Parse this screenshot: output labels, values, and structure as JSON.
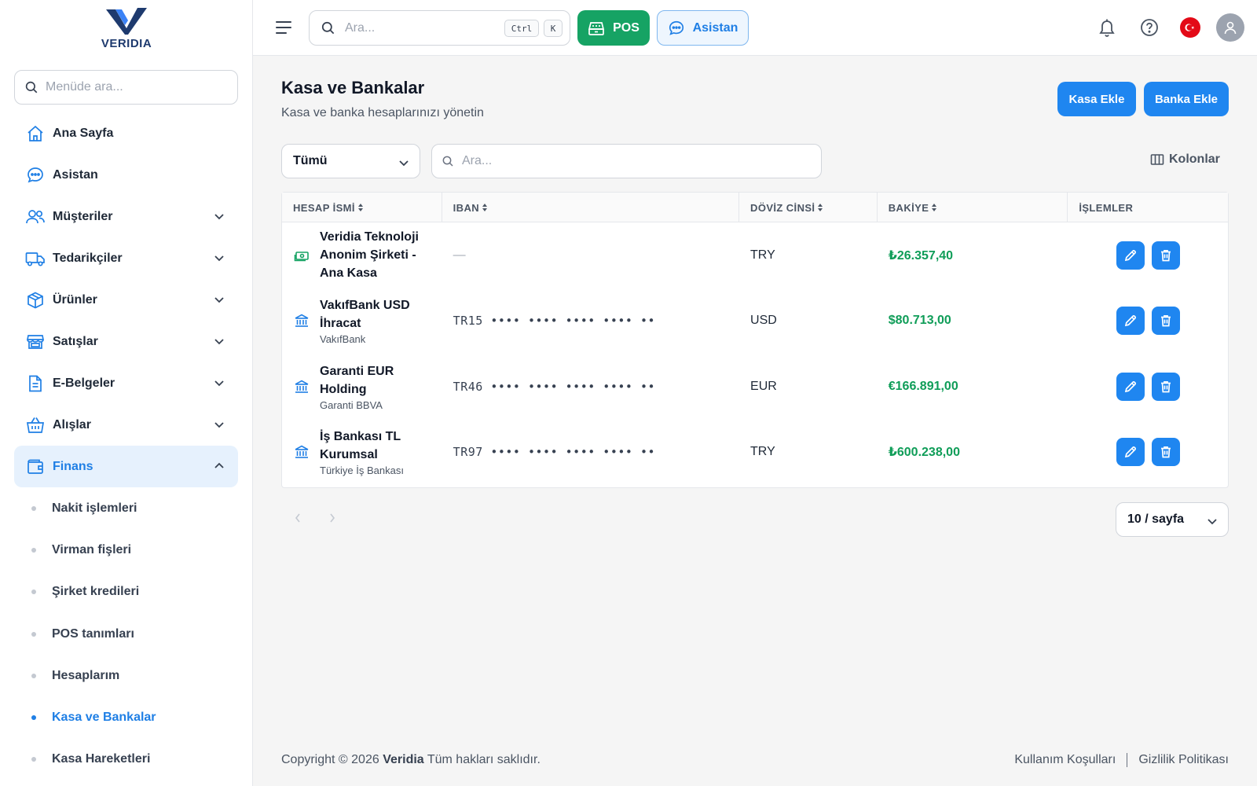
{
  "brand": {
    "name": "VERIDIA"
  },
  "sidebar": {
    "search_placeholder": "Menüde ara...",
    "items": [
      {
        "label": "Ana Sayfa",
        "icon": "home-icon"
      },
      {
        "label": "Asistan",
        "icon": "chat-icon"
      },
      {
        "label": "Müşteriler",
        "icon": "users-icon",
        "expandable": true
      },
      {
        "label": "Tedarikçiler",
        "icon": "truck-icon",
        "expandable": true
      },
      {
        "label": "Ürünler",
        "icon": "box-icon",
        "expandable": true
      },
      {
        "label": "Satışlar",
        "icon": "store-icon",
        "expandable": true
      },
      {
        "label": "E-Belgeler",
        "icon": "document-icon",
        "expandable": true
      },
      {
        "label": "Alışlar",
        "icon": "basket-icon",
        "expandable": true
      },
      {
        "label": "Finans",
        "icon": "wallet-icon",
        "expandable": true,
        "expanded": true,
        "active": true
      }
    ],
    "finans_sub": [
      {
        "label": "Nakit işlemleri"
      },
      {
        "label": "Virman fişleri"
      },
      {
        "label": "Şirket kredileri"
      },
      {
        "label": "POS tanımları"
      },
      {
        "label": "Hesaplarım"
      },
      {
        "label": "Kasa ve Bankalar",
        "active": true
      },
      {
        "label": "Kasa Hareketleri"
      }
    ]
  },
  "topbar": {
    "search_placeholder": "Ara...",
    "shortcut_ctrl": "Ctrl",
    "shortcut_key": "K",
    "pos_label": "POS",
    "assistant_label": "Asistan",
    "icons": [
      "bell-icon",
      "help-icon",
      "turkey-flag-icon",
      "user-avatar-icon"
    ]
  },
  "page": {
    "title": "Kasa ve Bankalar",
    "subtitle": "Kasa ve banka hesaplarınızı yönetin",
    "add_kasa": "Kasa Ekle",
    "add_banka": "Banka Ekle",
    "filter_value": "Tümü",
    "search_placeholder": "Ara...",
    "columns_label": "Kolonlar"
  },
  "table": {
    "headers": [
      "HESAP İSMİ",
      "IBAN",
      "DÖVİZ CİNSİ",
      "BAKİYE",
      "İŞLEMLER"
    ],
    "rows": [
      {
        "type": "kasa",
        "name": "Veridia Teknoloji Anonim Şirketi - Ana Kasa",
        "name_lines": [
          "Veridia Teknoloji",
          "Anonim Şirketi -",
          "Ana Kasa"
        ],
        "bank": "",
        "iban": "—",
        "currency": "TRY",
        "balance": "₺26.357,40"
      },
      {
        "type": "bank",
        "name": "VakıfBank USD İhracat",
        "name_lines": [
          "VakıfBank USD",
          "İhracat"
        ],
        "bank": "VakıfBank",
        "iban": "TR15 •••• •••• •••• •••• ••",
        "currency": "USD",
        "balance": "$80.713,00"
      },
      {
        "type": "bank",
        "name": "Garanti EUR Holding",
        "name_lines": [
          "Garanti EUR",
          "Holding"
        ],
        "bank": "Garanti BBVA",
        "iban": "TR46 •••• •••• •••• •••• ••",
        "currency": "EUR",
        "balance": "€166.891,00"
      },
      {
        "type": "bank",
        "name": "İş Bankası TL Kurumsal",
        "name_lines": [
          "İş Bankası TL",
          "Kurumsal"
        ],
        "bank": "Türkiye İş Bankası",
        "iban": "TR97 •••• •••• •••• •••• ••",
        "currency": "TRY",
        "balance": "₺600.238,00"
      }
    ]
  },
  "pagination": {
    "page_size": "10 / sayfa"
  },
  "footer": {
    "copyright_prefix": "Copyright © 2026",
    "company": "Veridia",
    "rights": "Tüm hakları saklıdır.",
    "terms": "Kullanım Koşulları",
    "privacy": "Gizlilik Politikası"
  },
  "colors": {
    "primary": "#1f86f0",
    "pos_green": "#16a364",
    "balance_green": "#0f9d58",
    "active_bg": "#e6f1fd"
  }
}
